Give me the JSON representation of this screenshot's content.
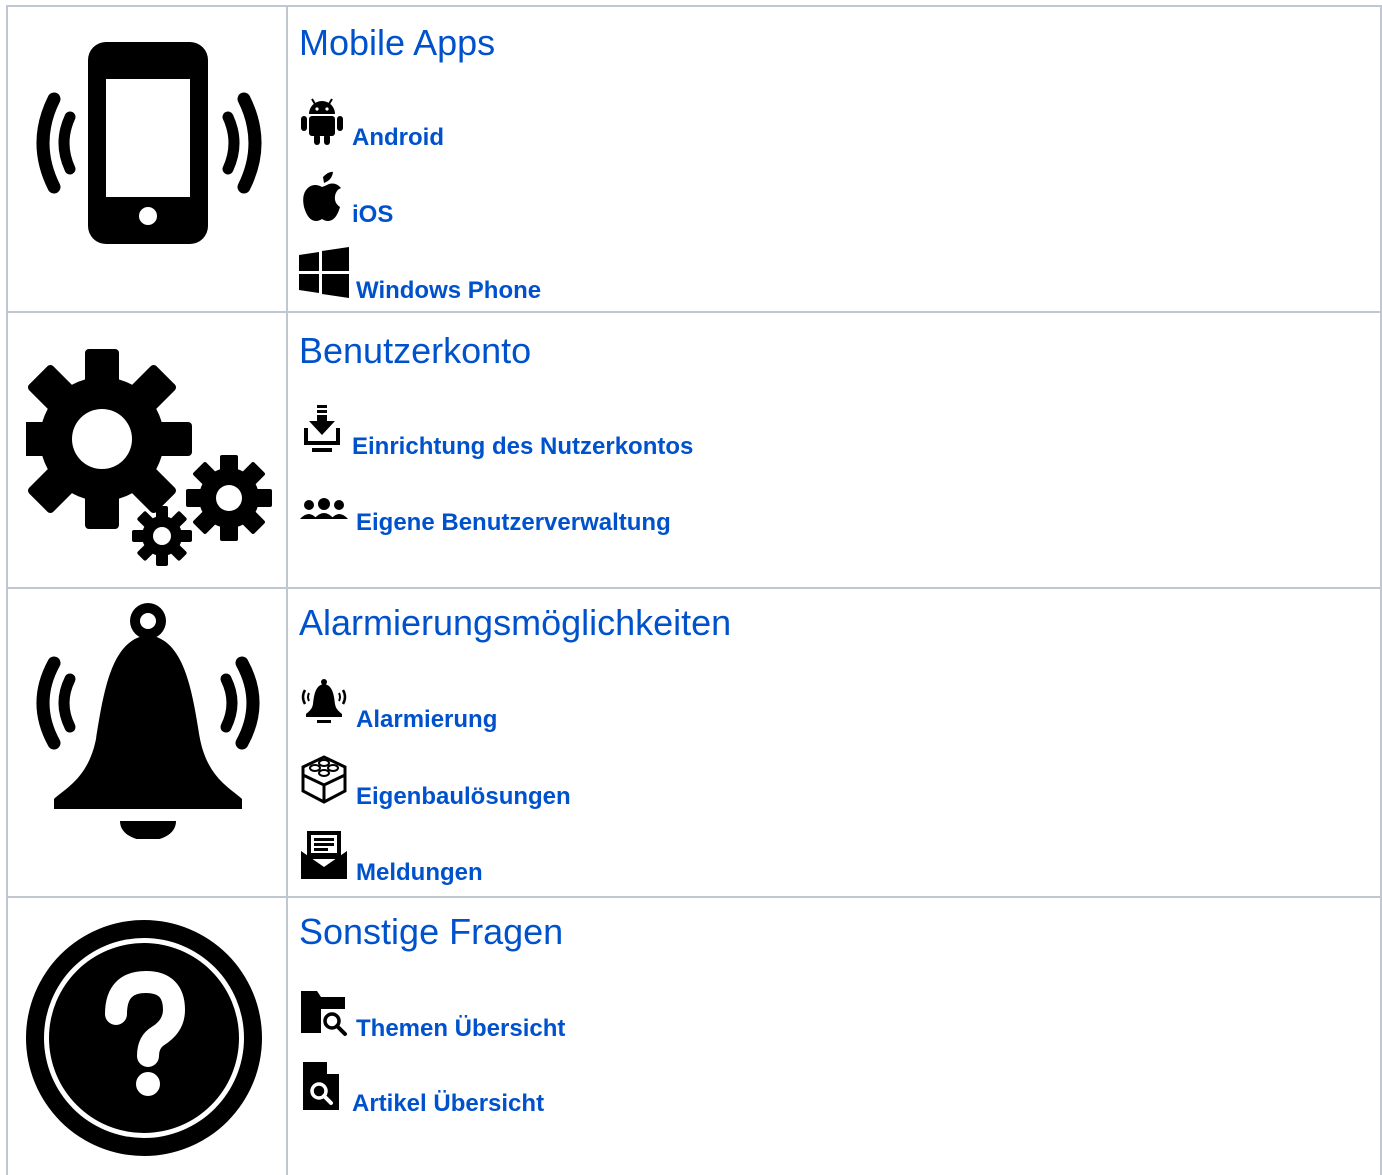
{
  "sections": [
    {
      "title": "Mobile Apps",
      "big_icon": "smartphone-vibrate-icon",
      "links": [
        {
          "label": "Android",
          "icon": "android-icon"
        },
        {
          "label": "iOS",
          "icon": "apple-icon"
        },
        {
          "label": "Windows Phone",
          "icon": "windows-icon"
        }
      ]
    },
    {
      "title": "Benutzerkonto",
      "big_icon": "gears-icon",
      "links": [
        {
          "label": "Einrichtung des Nutzerkontos",
          "icon": "download-tray-icon"
        },
        {
          "label": "Eigene Benutzerverwaltung",
          "icon": "user-group-icon"
        }
      ]
    },
    {
      "title": "Alarmierungsmöglichkeiten",
      "big_icon": "ringing-bell-icon",
      "links": [
        {
          "label": "Alarmierung",
          "icon": "ringing-bell-icon"
        },
        {
          "label": "Eigenbaulösungen",
          "icon": "building-block-icon"
        },
        {
          "label": "Meldungen",
          "icon": "message-envelope-icon"
        }
      ]
    },
    {
      "title": "Sonstige Fragen",
      "big_icon": "question-circle-icon",
      "links": [
        {
          "label": "Themen Übersicht",
          "icon": "folder-search-icon"
        },
        {
          "label": "Artikel Übersicht",
          "icon": "document-search-icon"
        }
      ]
    }
  ],
  "colors": {
    "link": "#0052cc",
    "border": "#c1c7d0",
    "icon": "#000000"
  }
}
